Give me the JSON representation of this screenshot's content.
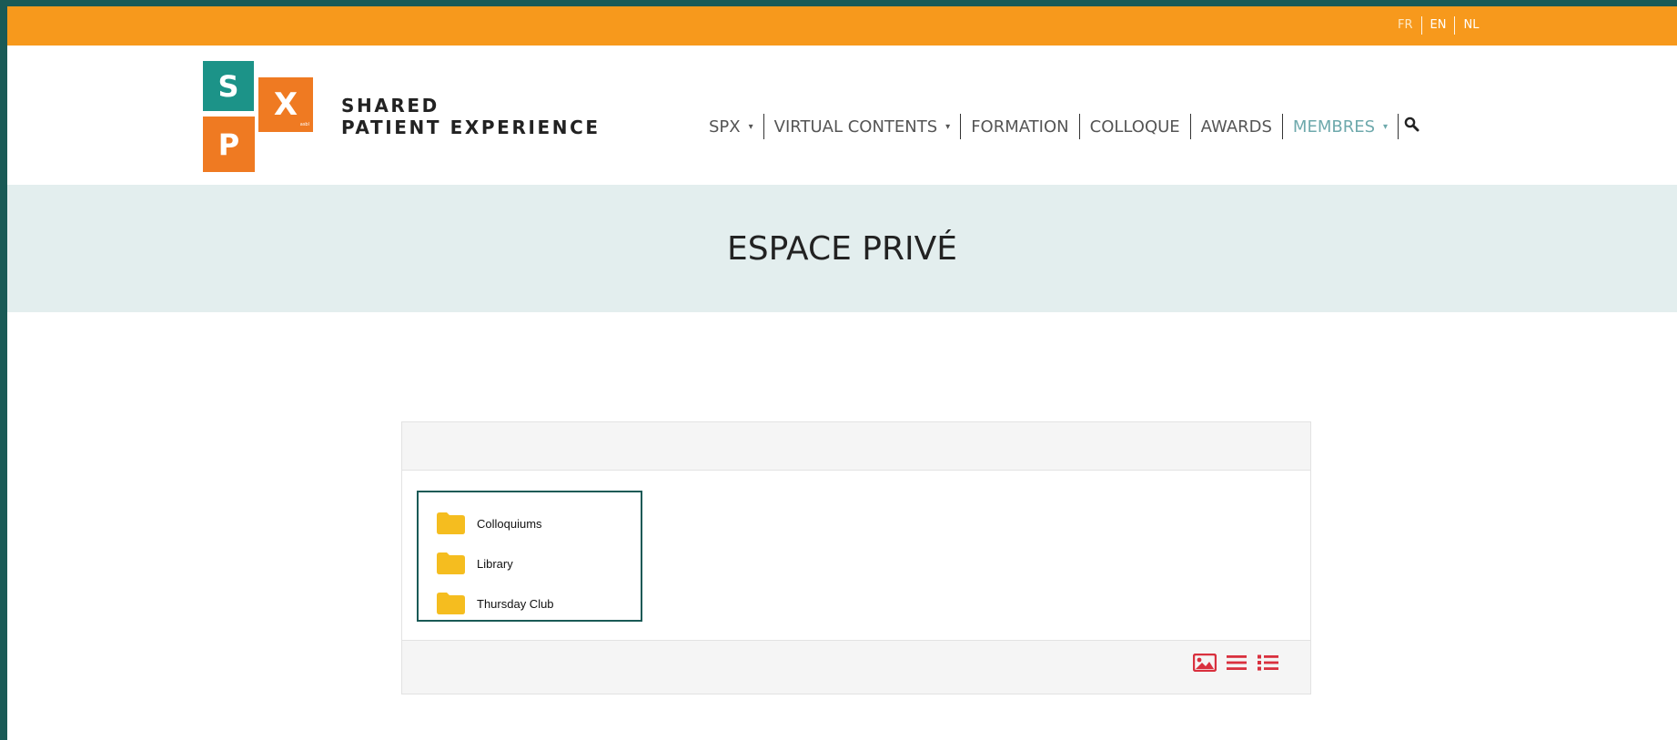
{
  "languages": [
    {
      "label": "FR",
      "active": true
    },
    {
      "label": "EN",
      "active": false
    },
    {
      "label": "NL",
      "active": false
    }
  ],
  "logo": {
    "s": "S",
    "x": "X",
    "p": "P",
    "tiny": "asbl"
  },
  "brand": {
    "line1": "SHARED",
    "line2": "PATIENT EXPERIENCE"
  },
  "nav": {
    "items": [
      {
        "label": "SPX",
        "dropdown": true,
        "active": false
      },
      {
        "label": "VIRTUAL CONTENTS",
        "dropdown": true,
        "active": false
      },
      {
        "label": "FORMATION",
        "dropdown": false,
        "active": false
      },
      {
        "label": "COLLOQUE",
        "dropdown": false,
        "active": false
      },
      {
        "label": "AWARDS",
        "dropdown": false,
        "active": false
      },
      {
        "label": "MEMBRES",
        "dropdown": true,
        "active": true
      }
    ],
    "caret": "▾",
    "search_icon": "search-icon"
  },
  "hero": {
    "title": "ESPACE PRIVÉ"
  },
  "file_browser": {
    "folders": [
      {
        "label": "Colloquiums"
      },
      {
        "label": "Library"
      },
      {
        "label": "Thursday Club"
      }
    ],
    "view_icons": [
      "image-view-icon",
      "list-view-icon",
      "detail-list-view-icon"
    ]
  },
  "colors": {
    "top_bar": "#f7991c",
    "logo_teal": "#1c9388",
    "logo_orange": "#ef7a22",
    "hero_bg": "#e3eeee",
    "active_nav": "#6ea9ac",
    "folder": "#f5bd1f",
    "view_icons": "#d9303e",
    "frame": "#1a5a56"
  }
}
